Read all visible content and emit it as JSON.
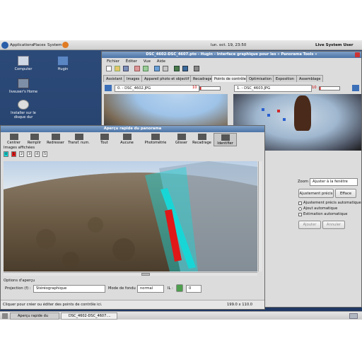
{
  "topbar": {
    "applications": "Applications",
    "places": "Places",
    "system": "System",
    "clock": "lun. oct. 19, 23:50",
    "user": "Live System User"
  },
  "desktop_icons": [
    {
      "label": "Computer"
    },
    {
      "label": "Hugin"
    },
    {
      "label": "liveuser's Home"
    },
    {
      "label": "Installer sur le disque dur"
    }
  ],
  "hugin": {
    "title": "DSC_4602-DSC_4607.pto - Hugin - Interface graphique pour les « Panorama Tools »",
    "menu": [
      "Fichier",
      "Éditer",
      "Vue",
      "Aide"
    ],
    "tabs": [
      "Assistant",
      "Images",
      "Appareil photo et objectif",
      "Recadrage",
      "Points de contrôle",
      "Optimisation",
      "Exposition",
      "Assemblage"
    ],
    "active_tab": "Points de contrôle",
    "left_image": {
      "select": "0. - DSC_4602.JPG",
      "value": "10"
    },
    "right_image": {
      "select": "1. - DSC_4603.JPG",
      "value": "10"
    },
    "zoom_label": "Zoom",
    "zoom_value": "Ajuster à la fenêtre",
    "fine_tune_button": "Ajustement précis",
    "delete_button": "Efface",
    "auto_fine_tune": "Ajustement précis automatique",
    "auto_add": "Ajout automatique",
    "auto_estimate": "Estimation automatique",
    "add_button": "Ajouter",
    "cancel_button": "Annuler"
  },
  "preview": {
    "title": "Aperçu rapide du panorama",
    "tools": [
      "Centrer",
      "Remplir",
      "Redresser",
      "Transf. num.",
      "Tout",
      "Aucune",
      "Photométrie",
      "Glisser",
      "Recadrage",
      "Identifier"
    ],
    "images_label": "Images affichées",
    "image_numbers": [
      "0",
      "1",
      "2",
      "3",
      "4",
      "5"
    ],
    "options_label": "Options d'aperçu",
    "projection_label": "Projection (f) :",
    "projection_value": "Stéréographique",
    "blend_label": "Mode de fondu :",
    "blend_value": "normal",
    "ev_label": "IL :",
    "ev_value": "0",
    "status": "Cliquer pour créer ou éditer des points de contrôle ici.",
    "coords": "199.0 x 110.0"
  },
  "taskbar": {
    "items": [
      "Aperçu rapide du pan...",
      "DSC_4602-DSC_4607...."
    ]
  },
  "colors": {
    "desktop": "#2b4872",
    "titlebar": "#4c74a6",
    "highlight_cyan": "#19d6d6",
    "highlight_red": "#e01818"
  }
}
